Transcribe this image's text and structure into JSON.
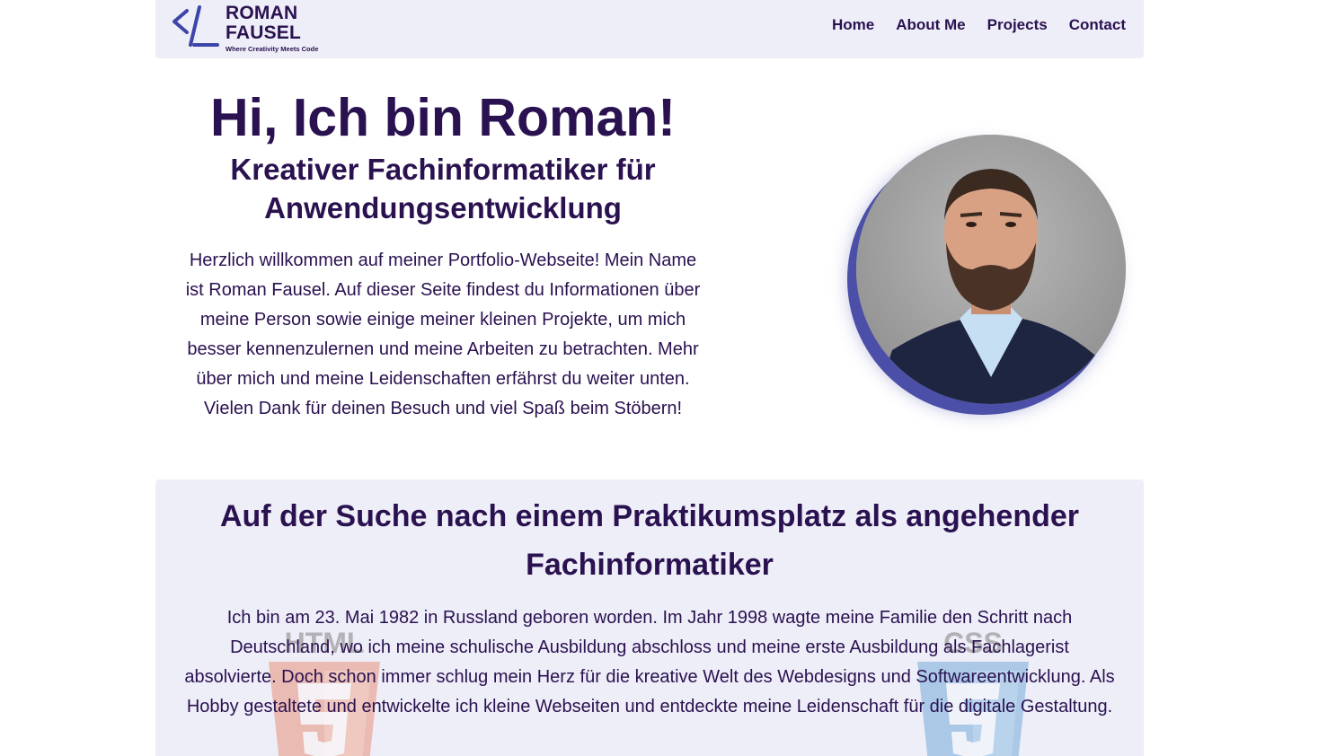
{
  "header": {
    "logo_name_line1": "ROMAN",
    "logo_name_line2": "FAUSEL",
    "logo_tagline": "Where Creativity Meets Code",
    "nav": [
      "Home",
      "About Me",
      "Projects",
      "Contact"
    ]
  },
  "hero": {
    "title": "Hi, Ich bin Roman!",
    "subtitle_line1": "Kreativer Fachinformatiker für",
    "subtitle_line2": "Anwendungsentwicklung",
    "intro": "Herzlich willkommen auf meiner Portfolio-Webseite! Mein Name ist Roman Fausel. Auf dieser Seite findest du Informationen über meine Person sowie einige meiner kleinen Projekte, um mich besser kennenzulernen und meine Arbeiten zu betrachten. Mehr über mich und meine Leidenschaften erfährst du weiter unten. Vielen Dank für deinen Besuch und viel Spaß beim Stöbern!"
  },
  "about": {
    "title": "Auf der Suche nach einem Praktikumsplatz als angehender Fachinformatiker",
    "text": "Ich bin am 23. Mai 1982 in Russland geboren worden. Im Jahr 1998 wagte meine Familie den Schritt nach Deutschland, wo ich meine schulische Ausbildung abschloss und meine erste Ausbildung als Fachlagerist absolvierte. Doch schon immer schlug mein Herz für die kreative Welt des Webdesigns und Softwareentwicklung. Als Hobby gestaltete und entwickelte ich kleine Webseiten und entdeckte meine Leidenschaft für die digitale Gestaltung.",
    "badges": [
      "HTML",
      "CSS"
    ]
  },
  "colors": {
    "primary": "#2a1150",
    "accent": "#4b4fa8",
    "panel": "#eeeef8",
    "html_badge": "#e44d26",
    "css_badge": "#1572b6"
  },
  "icons": {
    "logo": "code-slash-icon",
    "portrait": "profile-photo"
  }
}
